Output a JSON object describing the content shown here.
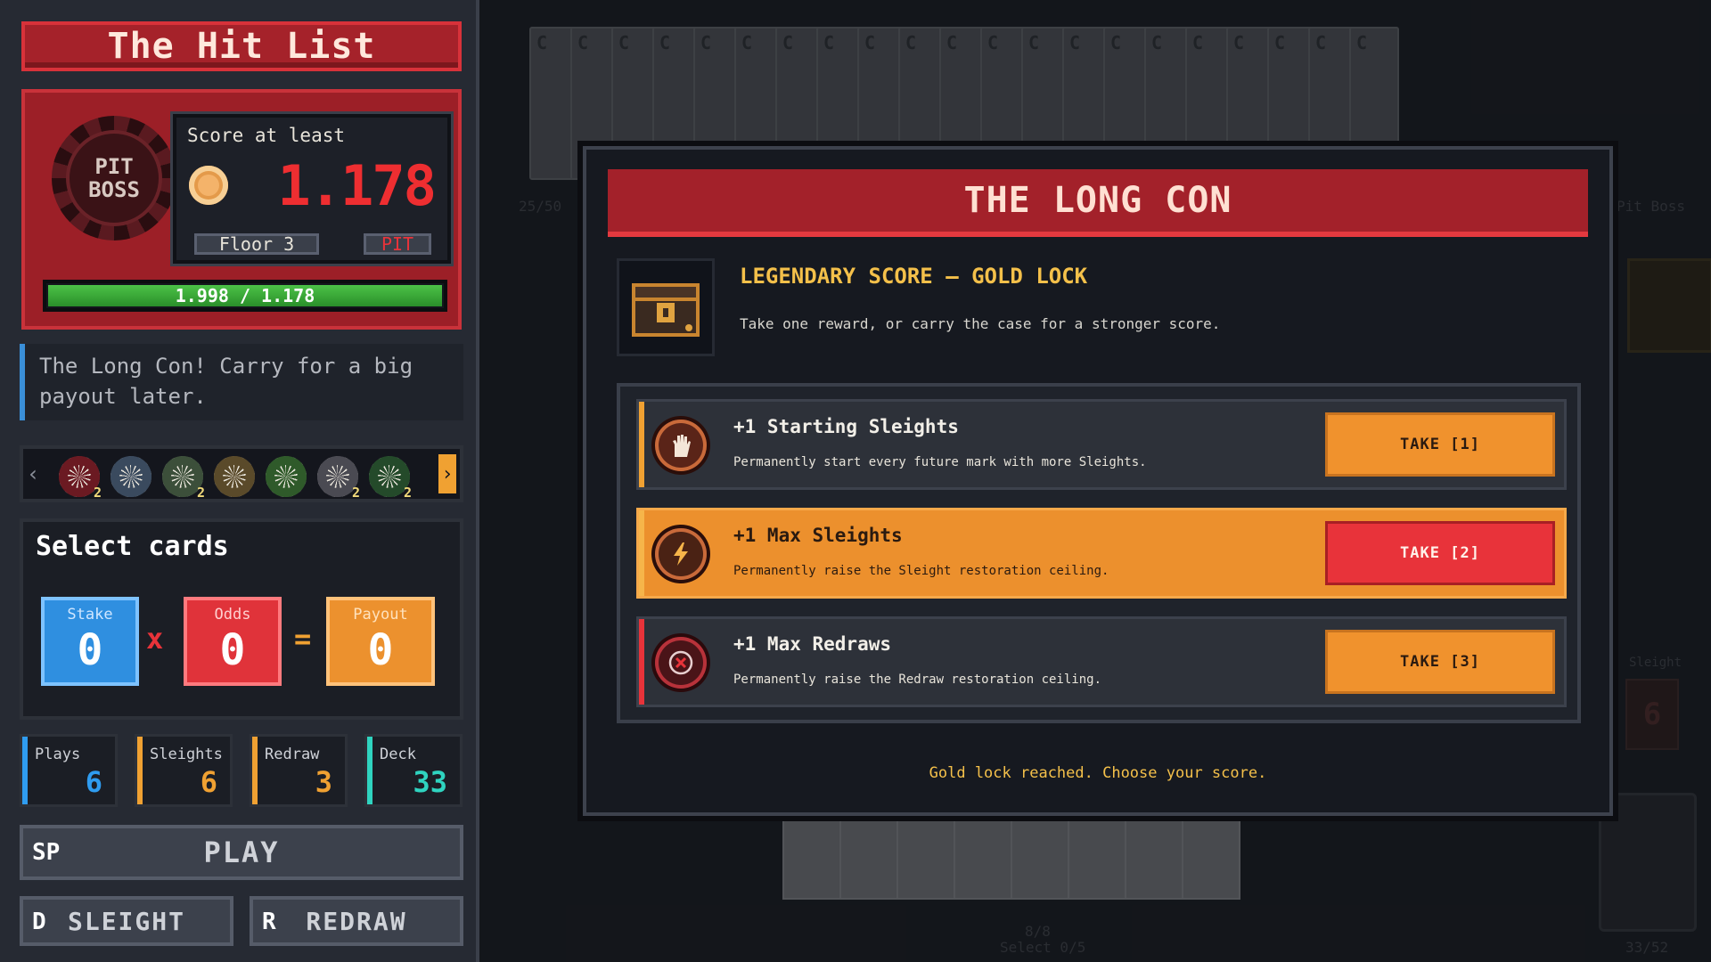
{
  "hit_list": {
    "title": "The Hit List",
    "boss_chip_line1": "PIT",
    "boss_chip_line2": "BOSS",
    "score_label": "Score at least",
    "score_target": "1.178",
    "floor_label": "Floor 3",
    "pit_label": "PIT",
    "progress_text": "1.998 / 1.178",
    "progress_fraction": 1.0,
    "hint": "The Long Con! Carry for a big payout later."
  },
  "chips": [
    {
      "icon": "spade-chip-icon",
      "color": "#6b1a22",
      "badge": "2"
    },
    {
      "icon": "cross-chip-icon",
      "color": "#3a4a5e",
      "badge": ""
    },
    {
      "icon": "cycle-chip-icon",
      "color": "#3c4f3a",
      "badge": "2"
    },
    {
      "icon": "sun-chip-icon",
      "color": "#5a4a2a",
      "badge": ""
    },
    {
      "icon": "star-chip-icon",
      "color": "#2f5a2a",
      "badge": ""
    },
    {
      "icon": "diamond-chip-icon",
      "color": "#4a4a52",
      "badge": "2"
    },
    {
      "icon": "green-chip-icon",
      "color": "#244a2a",
      "badge": "2"
    }
  ],
  "select": {
    "header": "Select cards",
    "stake_label": "Stake",
    "stake_value": "0",
    "odds_label": "Odds",
    "odds_value": "0",
    "payout_label": "Payout",
    "payout_value": "0",
    "times": "x",
    "equals": "="
  },
  "stats": [
    {
      "label": "Plays",
      "value": "6",
      "color": "#2f9cf0"
    },
    {
      "label": "Sleights",
      "value": "6",
      "color": "#f0a132"
    },
    {
      "label": "Redraw",
      "value": "3",
      "color": "#f0a132"
    },
    {
      "label": "Deck",
      "value": "33",
      "color": "#2fd4c0"
    }
  ],
  "buttons": {
    "play_key": "SP",
    "play_label": "PLAY",
    "sleight_key": "D",
    "sleight_label": "SLEIGHT",
    "redraw_key": "R",
    "redraw_label": "REDRAW"
  },
  "background": {
    "deck_count": "25/50",
    "right_label": "Pit Boss",
    "sleight_label": "Sleight",
    "sleight_value": "6",
    "hand_count": "8/8",
    "select_count": "Select 0/5",
    "draw_pile": "33/52"
  },
  "modal": {
    "title": "THE LONG CON",
    "subtitle": "LEGENDARY SCORE — GOLD LOCK",
    "description": "Take one reward, or carry the case for a stronger score.",
    "options": [
      {
        "title": "+1 Starting Sleights",
        "desc": "Permanently start every future mark with more Sleights.",
        "button": "TAKE [1]",
        "icon": "hand-icon",
        "stripe": "#f0a132"
      },
      {
        "title": "+1 Max Sleights",
        "desc": "Permanently raise the Sleight restoration ceiling.",
        "button": "TAKE [2]",
        "icon": "lightning-icon",
        "stripe": "#f0a132"
      },
      {
        "title": "+1 Max Redraws",
        "desc": "Permanently raise the Redraw restoration ceiling.",
        "button": "TAKE [3]",
        "icon": "redraw-icon",
        "stripe": "#e8333a"
      }
    ],
    "footer": "Gold lock reached. Choose your score."
  }
}
